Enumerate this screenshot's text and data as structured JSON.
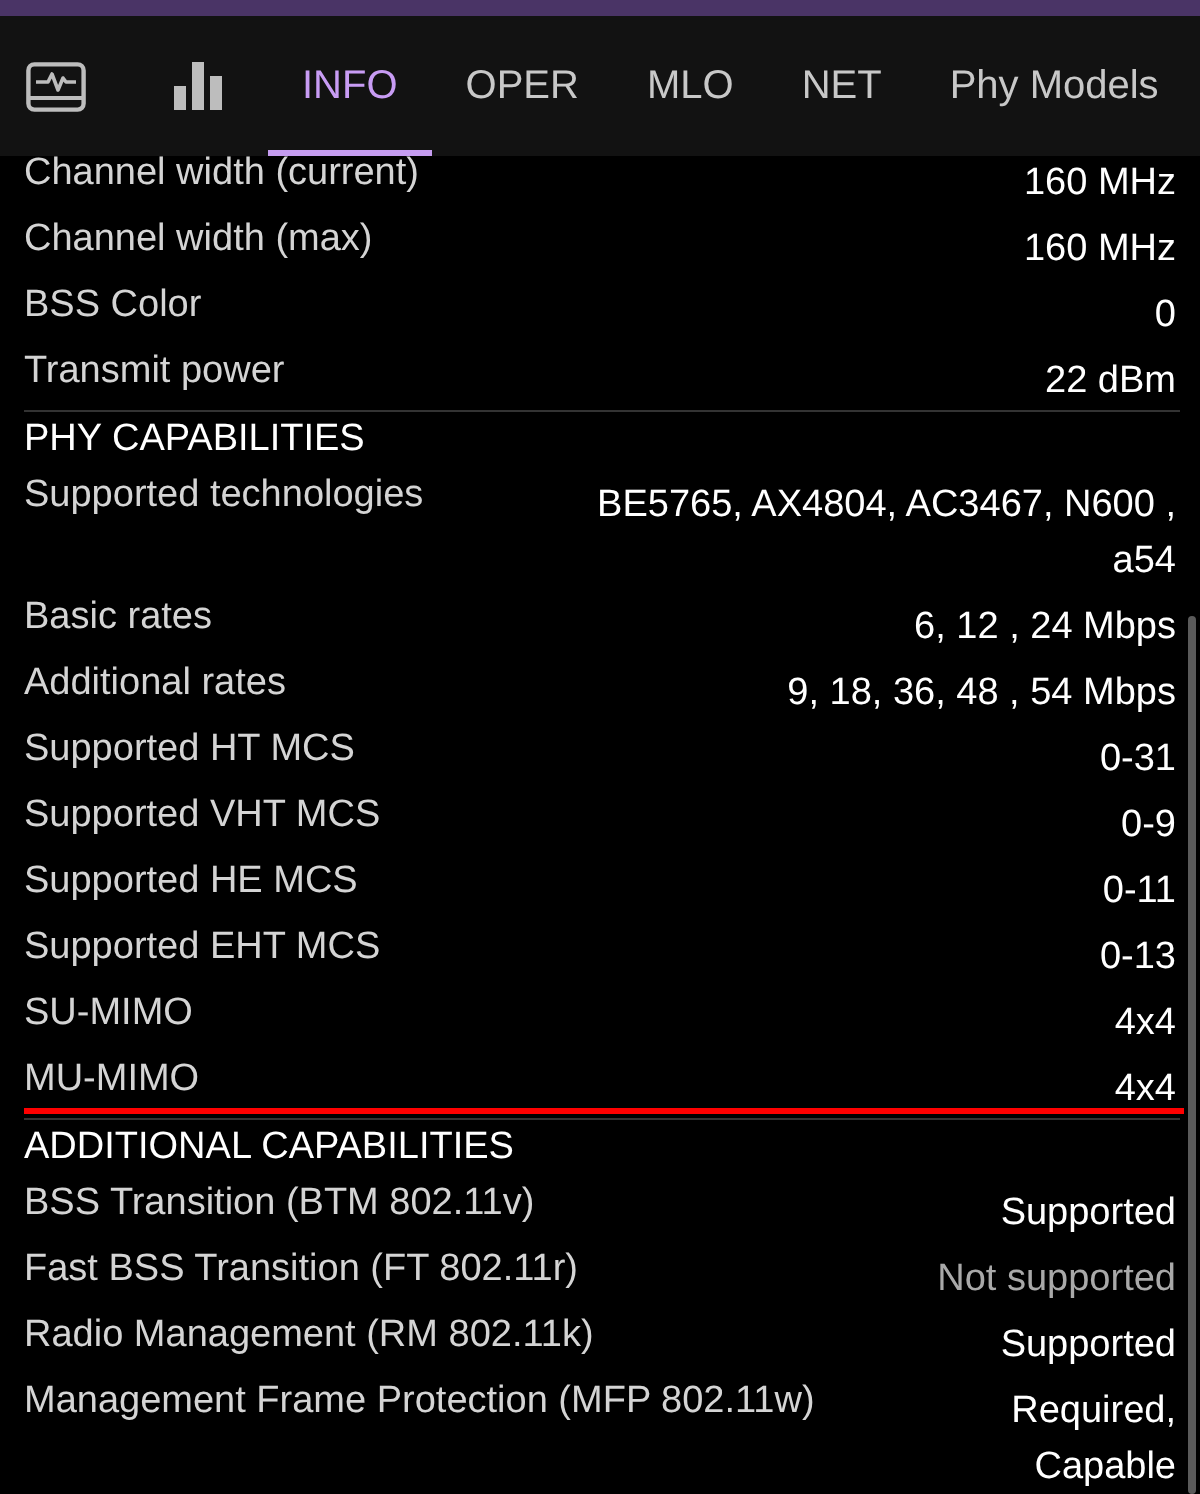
{
  "tabs": [
    {
      "label": "INFO",
      "selected": true
    },
    {
      "label": "OPER",
      "selected": false
    },
    {
      "label": "MLO",
      "selected": false
    },
    {
      "label": "NET",
      "selected": false
    },
    {
      "label": "Phy Models",
      "selected": false
    }
  ],
  "sections": [
    {
      "rows": [
        {
          "label": "Channel width (current)",
          "value": "160 MHz",
          "highlighted": false
        },
        {
          "label": "Channel width (max)",
          "value": "160 MHz",
          "highlighted": false
        },
        {
          "label": "BSS Color",
          "value": "0",
          "highlighted": false
        },
        {
          "label": "Transmit power",
          "value": "22 dBm",
          "highlighted": false
        }
      ]
    },
    {
      "title": "PHY CAPABILITIES",
      "rows": [
        {
          "label": "Supported technologies",
          "value": "BE5765, AX4804, AC3467, N600 , a54",
          "highlighted": false
        },
        {
          "label": "Basic rates",
          "value": "6, 12 , 24 Mbps",
          "highlighted": false
        },
        {
          "label": "Additional rates",
          "value": "9, 18, 36, 48 , 54 Mbps",
          "highlighted": false
        },
        {
          "label": "Supported HT MCS",
          "value": "0-31",
          "highlighted": false
        },
        {
          "label": "Supported VHT MCS",
          "value": "0-9",
          "highlighted": false
        },
        {
          "label": "Supported HE MCS",
          "value": "0-11",
          "highlighted": false
        },
        {
          "label": "Supported EHT MCS",
          "value": "0-13",
          "highlighted": false
        },
        {
          "label": "SU-MIMO",
          "value": "4x4",
          "highlighted": false
        },
        {
          "label": "MU-MIMO",
          "value": "4x4",
          "highlighted": true
        }
      ]
    },
    {
      "title": "ADDITIONAL CAPABILITIES",
      "rows": [
        {
          "label": "BSS Transition (BTM 802.11v)",
          "value": "Supported",
          "supported": true,
          "highlighted": false
        },
        {
          "label": "Fast BSS Transition (FT 802.11r)",
          "value": "Not supported",
          "supported": false,
          "highlighted": false
        },
        {
          "label": "Radio Management (RM 802.11k)",
          "value": "Supported",
          "supported": true,
          "highlighted": false
        },
        {
          "label": "Management Frame Protection (MFP 802.11w)",
          "value": "Required, Capable",
          "supported": true,
          "highlighted": false
        }
      ]
    }
  ]
}
